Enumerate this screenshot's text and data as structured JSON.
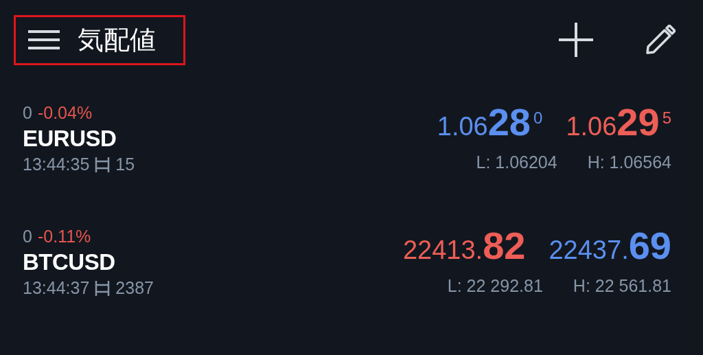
{
  "header": {
    "title": "気配値",
    "highlighted": true
  },
  "quotes": [
    {
      "change_points": "0",
      "change_percent": "-0.04%",
      "symbol": "EURUSD",
      "time": "13:44:35",
      "spread": "15",
      "bid": {
        "price": "1.06**28**$^{0}$",
        "color": "#5b8ff0"
      },
      "ask": {
        "price": "1.06**29**$^{5}$",
        "color": "#ee5e57"
      },
      "low": "L: 1.06204",
      "high": "H: 1.06564"
    },
    {
      "change_points": "0",
      "change_percent": "-0.11%",
      "symbol": "BTCUSD",
      "time": "13:44:37",
      "spread": "2387",
      "bid": {
        "price": "22413.**82**",
        "color": "#ee5e57"
      },
      "ask": {
        "price": "22437.**69**",
        "color": "#5b8ff0"
      },
      "low": "L: 22 292.81",
      "high": "H: 22 561.81"
    }
  ]
}
